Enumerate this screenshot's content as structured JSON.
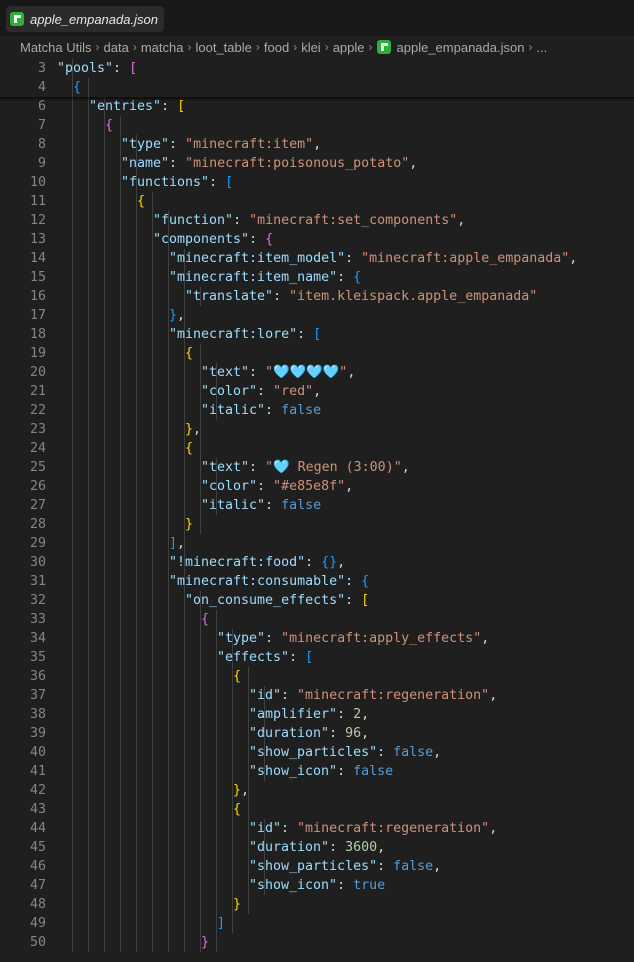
{
  "tab": {
    "label": "apple_empanada.json",
    "icon": "minecraft-file-icon"
  },
  "breadcrumb": {
    "items": [
      "Matcha Utils",
      "data",
      "matcha",
      "loot_table",
      "food",
      "klei",
      "apple",
      "apple_empanada.json",
      "..."
    ],
    "separator": "›"
  },
  "colors": {
    "background": "#1f1f1f",
    "key": "#9cdcfe",
    "string": "#ce9178",
    "number": "#b5cea8",
    "boolean": "#569cd6",
    "bracket_level1": "#ffd700",
    "bracket_level2": "#da70d6",
    "bracket_level3": "#179fff"
  },
  "editor": {
    "lines": [
      {
        "n": "3",
        "indent": 2,
        "t": [
          [
            "k",
            "\"pools\""
          ],
          [
            "p",
            ": "
          ],
          [
            "br2",
            "["
          ]
        ]
      },
      {
        "n": "4",
        "indent": 3,
        "t": [
          [
            "br3",
            "{"
          ]
        ]
      },
      {
        "n": "6",
        "indent": 4,
        "t": [
          [
            "k",
            "\"entries\""
          ],
          [
            "p",
            ": "
          ],
          [
            "br1",
            "["
          ]
        ]
      },
      {
        "n": "7",
        "indent": 5,
        "t": [
          [
            "br2",
            "{"
          ]
        ]
      },
      {
        "n": "8",
        "indent": 6,
        "t": [
          [
            "k",
            "\"type\""
          ],
          [
            "p",
            ": "
          ],
          [
            "s",
            "\"minecraft:item\""
          ],
          [
            "p",
            ","
          ]
        ]
      },
      {
        "n": "9",
        "indent": 6,
        "t": [
          [
            "k",
            "\"name\""
          ],
          [
            "p",
            ": "
          ],
          [
            "s",
            "\"minecraft:poisonous_potato\""
          ],
          [
            "p",
            ","
          ]
        ]
      },
      {
        "n": "10",
        "indent": 6,
        "t": [
          [
            "k",
            "\"functions\""
          ],
          [
            "p",
            ": "
          ],
          [
            "br3",
            "["
          ]
        ]
      },
      {
        "n": "11",
        "indent": 7,
        "t": [
          [
            "br1",
            "{"
          ]
        ]
      },
      {
        "n": "12",
        "indent": 8,
        "t": [
          [
            "k",
            "\"function\""
          ],
          [
            "p",
            ": "
          ],
          [
            "s",
            "\"minecraft:set_components\""
          ],
          [
            "p",
            ","
          ]
        ]
      },
      {
        "n": "13",
        "indent": 8,
        "t": [
          [
            "k",
            "\"components\""
          ],
          [
            "p",
            ": "
          ],
          [
            "br2",
            "{"
          ]
        ]
      },
      {
        "n": "14",
        "indent": 9,
        "t": [
          [
            "k",
            "\"minecraft:item_model\""
          ],
          [
            "p",
            ": "
          ],
          [
            "s",
            "\"minecraft:apple_empanada\""
          ],
          [
            "p",
            ","
          ]
        ]
      },
      {
        "n": "15",
        "indent": 9,
        "t": [
          [
            "k",
            "\"minecraft:item_name\""
          ],
          [
            "p",
            ": "
          ],
          [
            "br3",
            "{"
          ]
        ]
      },
      {
        "n": "16",
        "indent": 10,
        "t": [
          [
            "k",
            "\"translate\""
          ],
          [
            "p",
            ": "
          ],
          [
            "s",
            "\"item.kleispack.apple_empanada\""
          ]
        ]
      },
      {
        "n": "17",
        "indent": 9,
        "t": [
          [
            "br3",
            "}"
          ],
          [
            "p",
            ","
          ]
        ]
      },
      {
        "n": "18",
        "indent": 9,
        "t": [
          [
            "k",
            "\"minecraft:lore\""
          ],
          [
            "p",
            ": "
          ],
          [
            "br3",
            "["
          ]
        ]
      },
      {
        "n": "19",
        "indent": 10,
        "t": [
          [
            "br1",
            "{"
          ]
        ]
      },
      {
        "n": "20",
        "indent": 11,
        "t": [
          [
            "k",
            "\"text\""
          ],
          [
            "p",
            ": "
          ],
          [
            "s",
            "\"🩵🩵🩵🩵\""
          ],
          [
            "p",
            ","
          ]
        ]
      },
      {
        "n": "21",
        "indent": 11,
        "t": [
          [
            "k",
            "\"color\""
          ],
          [
            "p",
            ": "
          ],
          [
            "s",
            "\"red\""
          ],
          [
            "p",
            ","
          ]
        ]
      },
      {
        "n": "22",
        "indent": 11,
        "t": [
          [
            "k",
            "\"italic\""
          ],
          [
            "p",
            ": "
          ],
          [
            "b",
            "false"
          ]
        ]
      },
      {
        "n": "23",
        "indent": 10,
        "t": [
          [
            "br1",
            "}"
          ],
          [
            "p",
            ","
          ]
        ]
      },
      {
        "n": "24",
        "indent": 10,
        "t": [
          [
            "br1",
            "{"
          ]
        ]
      },
      {
        "n": "25",
        "indent": 11,
        "t": [
          [
            "k",
            "\"text\""
          ],
          [
            "p",
            ": "
          ],
          [
            "s",
            "\"🩵 Regen (3:00)\""
          ],
          [
            "p",
            ","
          ]
        ]
      },
      {
        "n": "26",
        "indent": 11,
        "t": [
          [
            "k",
            "\"color\""
          ],
          [
            "p",
            ": "
          ],
          [
            "s",
            "\"#e85e8f\""
          ],
          [
            "p",
            ","
          ]
        ]
      },
      {
        "n": "27",
        "indent": 11,
        "t": [
          [
            "k",
            "\"italic\""
          ],
          [
            "p",
            ": "
          ],
          [
            "b",
            "false"
          ]
        ]
      },
      {
        "n": "28",
        "indent": 10,
        "t": [
          [
            "br1",
            "}"
          ]
        ]
      },
      {
        "n": "29",
        "indent": 9,
        "t": [
          [
            "br3",
            "]"
          ],
          [
            "p",
            ","
          ]
        ]
      },
      {
        "n": "30",
        "indent": 9,
        "t": [
          [
            "k",
            "\"!minecraft:food\""
          ],
          [
            "p",
            ": "
          ],
          [
            "br3",
            "{}"
          ],
          [
            "p",
            ","
          ]
        ]
      },
      {
        "n": "31",
        "indent": 9,
        "t": [
          [
            "k",
            "\"minecraft:consumable\""
          ],
          [
            "p",
            ": "
          ],
          [
            "br3",
            "{"
          ]
        ]
      },
      {
        "n": "32",
        "indent": 10,
        "t": [
          [
            "k",
            "\"on_consume_effects\""
          ],
          [
            "p",
            ": "
          ],
          [
            "br1",
            "["
          ]
        ]
      },
      {
        "n": "33",
        "indent": 11,
        "t": [
          [
            "br2",
            "{"
          ]
        ]
      },
      {
        "n": "34",
        "indent": 12,
        "t": [
          [
            "k",
            "\"type\""
          ],
          [
            "p",
            ": "
          ],
          [
            "s",
            "\"minecraft:apply_effects\""
          ],
          [
            "p",
            ","
          ]
        ]
      },
      {
        "n": "35",
        "indent": 12,
        "t": [
          [
            "k",
            "\"effects\""
          ],
          [
            "p",
            ": "
          ],
          [
            "br3",
            "["
          ]
        ]
      },
      {
        "n": "36",
        "indent": 13,
        "t": [
          [
            "br1",
            "{"
          ]
        ]
      },
      {
        "n": "37",
        "indent": 14,
        "t": [
          [
            "k",
            "\"id\""
          ],
          [
            "p",
            ": "
          ],
          [
            "s",
            "\"minecraft:regeneration\""
          ],
          [
            "p",
            ","
          ]
        ]
      },
      {
        "n": "38",
        "indent": 14,
        "t": [
          [
            "k",
            "\"amplifier\""
          ],
          [
            "p",
            ": "
          ],
          [
            "n",
            "2"
          ],
          [
            "p",
            ","
          ]
        ]
      },
      {
        "n": "39",
        "indent": 14,
        "t": [
          [
            "k",
            "\"duration\""
          ],
          [
            "p",
            ": "
          ],
          [
            "n",
            "96"
          ],
          [
            "p",
            ","
          ]
        ]
      },
      {
        "n": "40",
        "indent": 14,
        "t": [
          [
            "k",
            "\"show_particles\""
          ],
          [
            "p",
            ": "
          ],
          [
            "b",
            "false"
          ],
          [
            "p",
            ","
          ]
        ]
      },
      {
        "n": "41",
        "indent": 14,
        "t": [
          [
            "k",
            "\"show_icon\""
          ],
          [
            "p",
            ": "
          ],
          [
            "b",
            "false"
          ]
        ]
      },
      {
        "n": "42",
        "indent": 13,
        "t": [
          [
            "br1",
            "}"
          ],
          [
            "p",
            ","
          ]
        ]
      },
      {
        "n": "43",
        "indent": 13,
        "t": [
          [
            "br1",
            "{"
          ]
        ]
      },
      {
        "n": "44",
        "indent": 14,
        "t": [
          [
            "k",
            "\"id\""
          ],
          [
            "p",
            ": "
          ],
          [
            "s",
            "\"minecraft:regeneration\""
          ],
          [
            "p",
            ","
          ]
        ]
      },
      {
        "n": "45",
        "indent": 14,
        "t": [
          [
            "k",
            "\"duration\""
          ],
          [
            "p",
            ": "
          ],
          [
            "n",
            "3600"
          ],
          [
            "p",
            ","
          ]
        ]
      },
      {
        "n": "46",
        "indent": 14,
        "t": [
          [
            "k",
            "\"show_particles\""
          ],
          [
            "p",
            ": "
          ],
          [
            "b",
            "false"
          ],
          [
            "p",
            ","
          ]
        ]
      },
      {
        "n": "47",
        "indent": 14,
        "t": [
          [
            "k",
            "\"show_icon\""
          ],
          [
            "p",
            ": "
          ],
          [
            "b",
            "true"
          ]
        ]
      },
      {
        "n": "48",
        "indent": 13,
        "t": [
          [
            "br1",
            "}"
          ]
        ]
      },
      {
        "n": "49",
        "indent": 12,
        "t": [
          [
            "br3",
            "]"
          ]
        ]
      },
      {
        "n": "50",
        "indent": 11,
        "t": [
          [
            "br2",
            "}"
          ]
        ]
      }
    ]
  }
}
